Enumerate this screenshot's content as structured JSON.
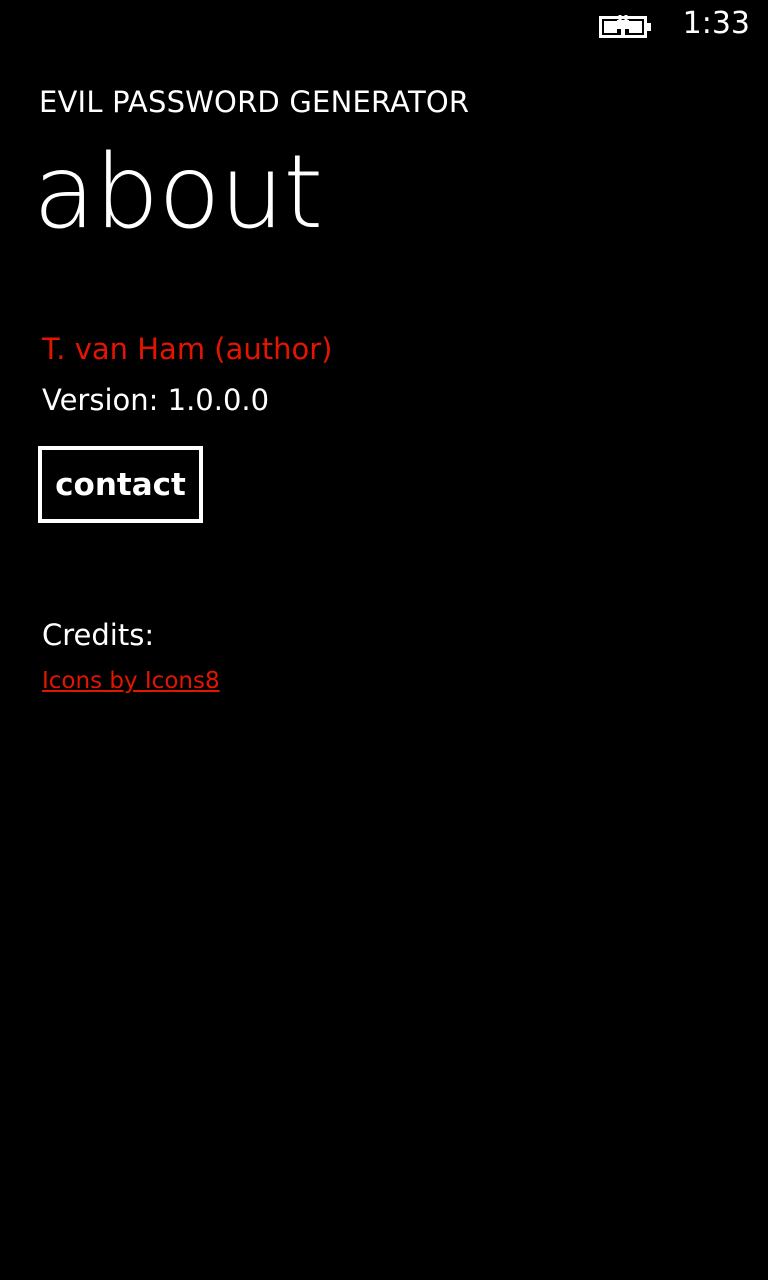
{
  "status_bar": {
    "battery_icon": "battery-charging-icon",
    "time": "1:33"
  },
  "header": {
    "app_title": "EVIL PASSWORD GENERATOR",
    "page_title": "about"
  },
  "about": {
    "author": "T. van Ham (author)",
    "version_label": "Version:",
    "version_value": "1.0.0.0",
    "contact_button": "contact",
    "credits_label": "Credits:",
    "credits_link": "Icons by Icons8"
  },
  "colors": {
    "background": "#000000",
    "foreground": "#ffffff",
    "accent": "#e51400"
  }
}
